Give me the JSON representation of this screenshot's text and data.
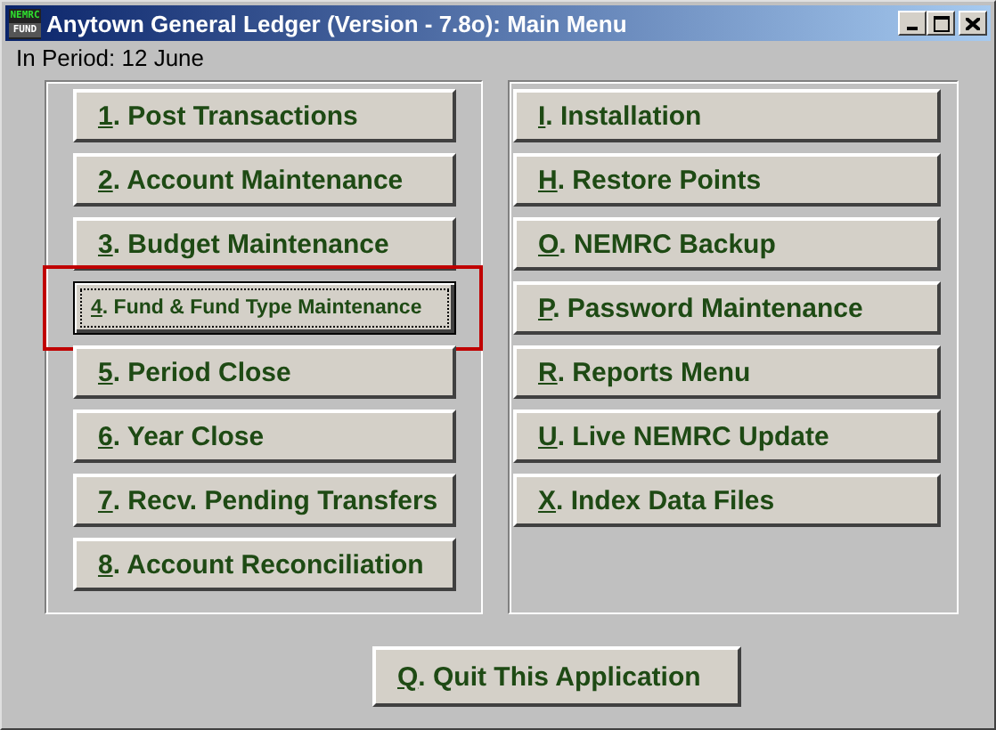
{
  "window": {
    "title": "Anytown General Ledger (Version - 7.8o):  Main Menu",
    "logo_top": "NEMRC",
    "logo_bottom": "FUND"
  },
  "period": "In Period: 12 June",
  "left_menu": [
    {
      "key": "1",
      "label": ". Post Transactions",
      "focused": false
    },
    {
      "key": "2",
      "label": ". Account Maintenance",
      "focused": false
    },
    {
      "key": "3",
      "label": ". Budget Maintenance",
      "focused": false
    },
    {
      "key": "4",
      "label": ". Fund & Fund Type Maintenance",
      "focused": true
    },
    {
      "key": "5",
      "label": ". Period Close",
      "focused": false
    },
    {
      "key": "6",
      "label": ". Year Close",
      "focused": false
    },
    {
      "key": "7",
      "label": ". Recv. Pending Transfers",
      "focused": false
    },
    {
      "key": "8",
      "label": ". Account Reconciliation",
      "focused": false
    }
  ],
  "right_menu": [
    {
      "key": "I",
      "label": ". Installation",
      "focused": false
    },
    {
      "key": "H",
      "label": ". Restore Points",
      "focused": false
    },
    {
      "key": "O",
      "label": ". NEMRC Backup",
      "focused": false
    },
    {
      "key": "P",
      "label": ". Password Maintenance",
      "focused": false
    },
    {
      "key": "R",
      "label": ". Reports Menu",
      "focused": false
    },
    {
      "key": "U",
      "label": ". Live NEMRC Update",
      "focused": false
    },
    {
      "key": "X",
      "label": ". Index Data Files",
      "focused": false
    }
  ],
  "quit": {
    "key": "Q",
    "label": ". Quit This Application",
    "focused": false
  }
}
